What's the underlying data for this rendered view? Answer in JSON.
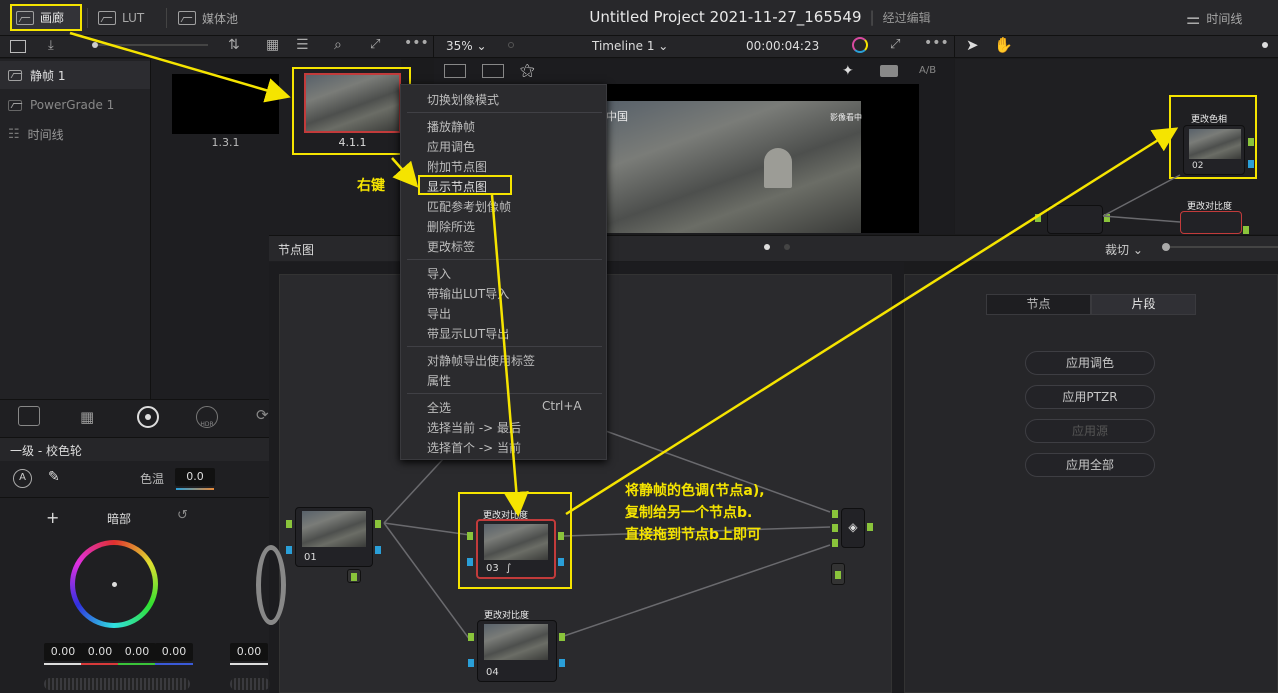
{
  "topbar": {
    "gallery": "画廊",
    "lut": "LUT",
    "media_pool": "媒体池",
    "project_title": "Untitled Project 2021-11-27_165549",
    "edited": "经过编辑",
    "timeline": "时间线"
  },
  "viewer": {
    "zoom": "35%",
    "timeline_name": "Timeline 1",
    "timecode": "00:00:04:23",
    "ab": "A/B",
    "overlay_left": "中国",
    "overlay_right": "影像看中"
  },
  "sidebar": {
    "items": [
      {
        "label": "静帧 1"
      },
      {
        "label": "PowerGrade 1"
      },
      {
        "label": "时间线"
      }
    ]
  },
  "stills": [
    {
      "label": "1.3.1"
    },
    {
      "label": "4.1.1"
    }
  ],
  "context_menu": {
    "items": [
      "切换划像模式",
      "播放静帧",
      "应用调色",
      "附加节点图",
      "显示节点图",
      "匹配参考划像帧",
      "删除所选",
      "更改标签",
      "导入",
      "带输出LUT导入",
      "导出",
      "带显示LUT导出",
      "对静帧导出使用标签",
      "属性",
      "全选",
      "选择当前 -> 最后",
      "选择首个 -> 当前"
    ],
    "shortcut": "Ctrl+A"
  },
  "annotations": {
    "right_click": "右键",
    "note1": "将静帧的色调(节点a),",
    "note2": "复制给另一个节点b.",
    "note3": "直接拖到节点b上即可"
  },
  "node_editor": {
    "title": "节点图",
    "crop": "裁切",
    "nodes": [
      {
        "id": "01",
        "title": ""
      },
      {
        "id": "03",
        "title": "更改对比度"
      },
      {
        "id": "04",
        "title": "更改对比度"
      }
    ]
  },
  "mini_nodes": [
    {
      "id": "02",
      "title": "更改色相"
    },
    {
      "id": "",
      "title": "更改对比度"
    }
  ],
  "right_panel": {
    "tabs": [
      "节点",
      "片段"
    ],
    "buttons": [
      "应用调色",
      "应用PTZR",
      "应用源",
      "应用全部"
    ]
  },
  "color_panel": {
    "title": "一级 - 校色轮",
    "temp_label": "色温",
    "temp_value": "0.0",
    "wheel_label": "暗部",
    "values": [
      "0.00",
      "0.00",
      "0.00",
      "0.00",
      "0.00"
    ]
  },
  "colors": {
    "accent": "#f5e400",
    "node_red": "#c23b3b",
    "pin_green": "#8ac43b",
    "pin_blue": "#2a9fd8"
  }
}
